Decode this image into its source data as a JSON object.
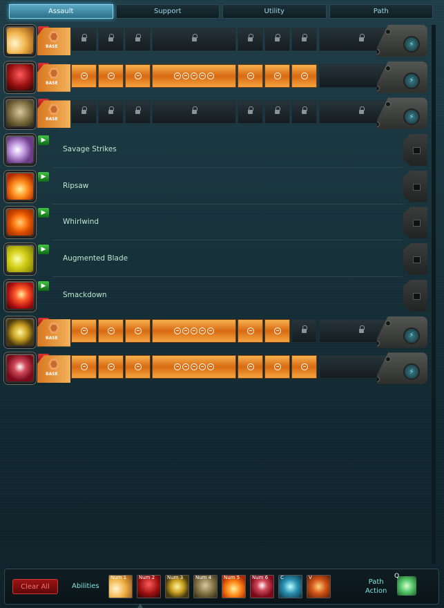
{
  "tabs": [
    {
      "label": "Assault",
      "active": true
    },
    {
      "label": "Support",
      "active": false
    },
    {
      "label": "Utility",
      "active": false
    },
    {
      "label": "Path",
      "active": false
    }
  ],
  "base_label": "BASE",
  "slotted_abilities": [
    {
      "icon": "sword-slash-icon",
      "tiers_unlocked": 0
    },
    {
      "icon": "red-strike-icon",
      "tiers_unlocked": 8
    },
    {
      "icon": "khaki-tactic-icon",
      "tiers_unlocked": 0
    },
    {
      "icon": "gold-rally-icon",
      "tiers_unlocked": 7
    },
    {
      "icon": "crimson-blade-icon",
      "tiers_unlocked": 8
    }
  ],
  "available_abilities": [
    {
      "name": "Savage Strikes",
      "icon": "savage-strikes-icon"
    },
    {
      "name": "Ripsaw",
      "icon": "ripsaw-icon"
    },
    {
      "name": "Whirlwind",
      "icon": "whirlwind-icon"
    },
    {
      "name": "Augmented Blade",
      "icon": "augmented-blade-icon"
    },
    {
      "name": "Smackdown",
      "icon": "smackdown-icon"
    }
  ],
  "bottom": {
    "clear_all": "Clear All",
    "abilities_label": "Abilities",
    "keybinds": [
      "Num 1",
      "Num 2",
      "Num 3",
      "Num 4",
      "Num 5",
      "Num 6",
      "C",
      "V"
    ],
    "path_action_label_line1": "Path",
    "path_action_label_line2": "Action",
    "path_action_key": "Q"
  }
}
